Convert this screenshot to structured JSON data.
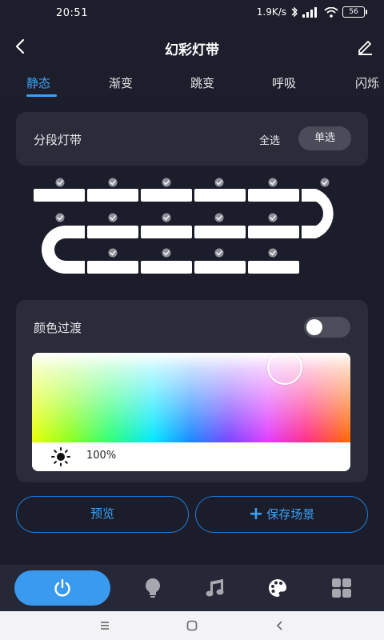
{
  "status": {
    "time": "20:51",
    "speed": "1.9K/s",
    "battery": "56"
  },
  "header": {
    "title": "幻彩灯带",
    "back_icon": "chevron-left-icon",
    "edit_icon": "pencil-icon"
  },
  "tabs": [
    {
      "label": "静态",
      "active": true
    },
    {
      "label": "渐变",
      "active": false
    },
    {
      "label": "跳变",
      "active": false
    },
    {
      "label": "呼吸",
      "active": false
    },
    {
      "label": "闪烁",
      "active": false
    }
  ],
  "segment": {
    "label": "分段灯带",
    "select_all": "全选",
    "single_select": "单选"
  },
  "color": {
    "label": "颜色过渡",
    "transition_enabled": false,
    "brightness": "100%"
  },
  "buttons": {
    "preview": "预览",
    "save_scene": "保存场景",
    "save_icon": "plus-icon"
  },
  "bottom_nav": [
    {
      "icon": "power-icon",
      "active": true
    },
    {
      "icon": "bulb-icon",
      "active": false
    },
    {
      "icon": "music-note-icon",
      "active": false
    },
    {
      "icon": "palette-icon",
      "active": false
    },
    {
      "icon": "grid-icon",
      "active": false
    }
  ],
  "colors": {
    "accent": "#3ea0f5",
    "background": "#1b1d2a",
    "card": "#2a2c3a",
    "nav": "#262837"
  }
}
